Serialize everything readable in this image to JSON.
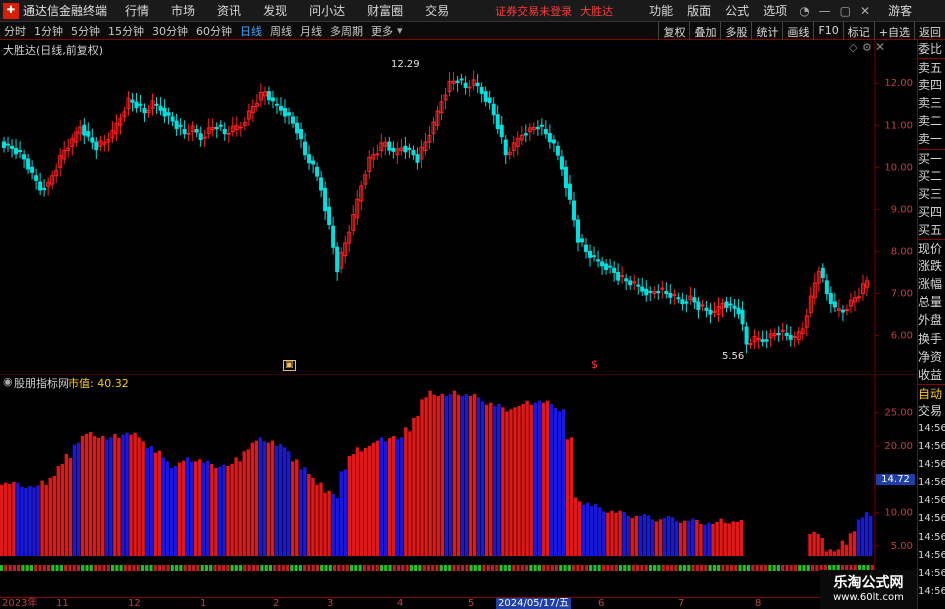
{
  "app": {
    "title": "通达信金融终端",
    "notice": "证券交易未登录",
    "stock_name": "大胜达"
  },
  "menu": [
    "行情",
    "市场",
    "资讯",
    "发现",
    "问小达",
    "财富圈",
    "交易"
  ],
  "top_right": [
    "功能",
    "版面",
    "公式",
    "选项"
  ],
  "guest": "游客",
  "icons": [
    "help-icon",
    "minimize-icon",
    "maximize-icon",
    "close-icon"
  ],
  "periods": [
    "分时",
    "1分钟",
    "5分钟",
    "15分钟",
    "30分钟",
    "60分钟",
    "日线",
    "周线",
    "月线",
    "多周期",
    "更多"
  ],
  "active_period": "日线",
  "period_tools": [
    "复权",
    "叠加",
    "多股",
    "统计",
    "画线",
    "F10",
    "标记",
    "+自选",
    "返回"
  ],
  "main": {
    "title": "大胜达(日线,前复权)",
    "high_label": "12.29",
    "low_label": "5.56",
    "axis": [
      "12.00",
      "11.00",
      "10.00",
      "9.00",
      "8.00",
      "7.00",
      "6.00"
    ],
    "marker_s": "$"
  },
  "sub": {
    "title": "股朋指标网",
    "value_label": "市值: 40.32",
    "axis": [
      "25.00",
      "20.00",
      "15.00",
      "10.00",
      "5.00"
    ],
    "current_value": "14.72"
  },
  "quote_panel": [
    "委比",
    "卖五",
    "卖四",
    "卖三",
    "卖二",
    "卖一",
    "买一",
    "买二",
    "买三",
    "买四",
    "买五",
    "现价",
    "涨跌",
    "涨幅",
    "总量",
    "外盘",
    "换手",
    "净资",
    "收益"
  ],
  "quote_panel2": [
    "自动",
    "交易"
  ],
  "quote_times": [
    "14:56",
    "14:56",
    "14:56",
    "14:56",
    "14:56",
    "14:56",
    "14:56",
    "14:56",
    "14:56",
    "14:56"
  ],
  "dates": {
    "labels": [
      "2023年",
      "11",
      "12",
      "1",
      "2",
      "3",
      "4",
      "5",
      "6",
      "7",
      "8",
      "9"
    ],
    "selected": "2024/05/17/五"
  },
  "watermark": {
    "line1": "乐淘公式网",
    "line2": "www.60lt.com"
  },
  "colors": {
    "up": "#ff2020",
    "down": "#00e0e0",
    "bar_red": "#e01818",
    "bar_blue": "#1818e0",
    "grid": "#800000",
    "accent": "#4aa8ff"
  },
  "chart_data": {
    "type": "candlestick",
    "price_ylim": [
      5.3,
      12.6
    ],
    "sub_type": "bar",
    "sub_ylim": [
      3.5,
      29
    ],
    "close_series": [
      10.5,
      10.4,
      10.2,
      9.8,
      9.5,
      9.6,
      10.0,
      10.4,
      10.6,
      11.0,
      10.7,
      10.5,
      10.6,
      10.8,
      11.2,
      11.6,
      11.5,
      11.3,
      11.5,
      11.4,
      11.2,
      11.0,
      10.8,
      10.9,
      10.7,
      10.9,
      11.0,
      10.8,
      10.9,
      11.0,
      11.3,
      11.6,
      11.8,
      11.5,
      11.4,
      11.2,
      10.9,
      10.3,
      10.0,
      9.5,
      8.6,
      7.6,
      8.2,
      8.8,
      9.6,
      10.2,
      10.4,
      10.6,
      10.3,
      10.5,
      10.4,
      10.2,
      10.6,
      11.0,
      11.6,
      12.0,
      12.1,
      11.9,
      12.0,
      11.8,
      11.5,
      11.0,
      10.3,
      10.5,
      10.8,
      10.9,
      11.0,
      10.8,
      10.5,
      10.0,
      9.2,
      8.3,
      8.0,
      7.8,
      7.7,
      7.6,
      7.4,
      7.3,
      7.2,
      7.1,
      7.0,
      7.1,
      7.0,
      6.9,
      6.8,
      6.9,
      6.7,
      6.6,
      6.5,
      6.8,
      6.7,
      6.6,
      5.8,
      5.9,
      5.9,
      6.0,
      6.1,
      6.0,
      5.9,
      6.2,
      6.9,
      7.6,
      7.0,
      6.6,
      6.6,
      6.8,
      7.0,
      7.3
    ],
    "sub_values": [
      14.5,
      14.3,
      14.2,
      14.0,
      13.8,
      14.5,
      15.5,
      17.0,
      18.5,
      20.5,
      21.5,
      21.8,
      21.5,
      21.0,
      21.5,
      22.0,
      21.7,
      21.0,
      20.0,
      19.0,
      18.0,
      17.0,
      17.5,
      18.0,
      18.0,
      17.5,
      17.0,
      17.2,
      17.0,
      18.0,
      19.5,
      20.5,
      21.0,
      20.8,
      20.0,
      19.5,
      18.0,
      16.5,
      15.5,
      14.5,
      13.0,
      12.5,
      16.5,
      18.5,
      19.5,
      20.0,
      20.5,
      21.0,
      21.5,
      21.0,
      22.5,
      24.5,
      27.0,
      28.0,
      27.8,
      27.5,
      28.0,
      27.8,
      27.5,
      27.0,
      26.5,
      26.0,
      25.5,
      25.8,
      26.0,
      26.5,
      26.8,
      26.5,
      26.0,
      25.5,
      21.0,
      12.0,
      11.5,
      11.0,
      10.5,
      10.3,
      10.0,
      9.8,
      9.5,
      9.5,
      9.3,
      9.0,
      9.2,
      9.0,
      8.8,
      8.8,
      8.6,
      8.5,
      8.3,
      8.8,
      8.7,
      8.6,
      0,
      0,
      0,
      0,
      0,
      0,
      0,
      0,
      6.8,
      6.5,
      4.5,
      4.2,
      5.5,
      7.2,
      9.0,
      9.8
    ],
    "sub_colors": "RRBBBRRRRBRRRBRBRRBRBBRBRBRBRRRRBRBBRBRRRBBRRRRBRBRRRRRBRBRBRBRRRRBRBBRRBBBRRBRBBRBBRBRBRRRRRRRRRRRBRRRRRR"
  }
}
